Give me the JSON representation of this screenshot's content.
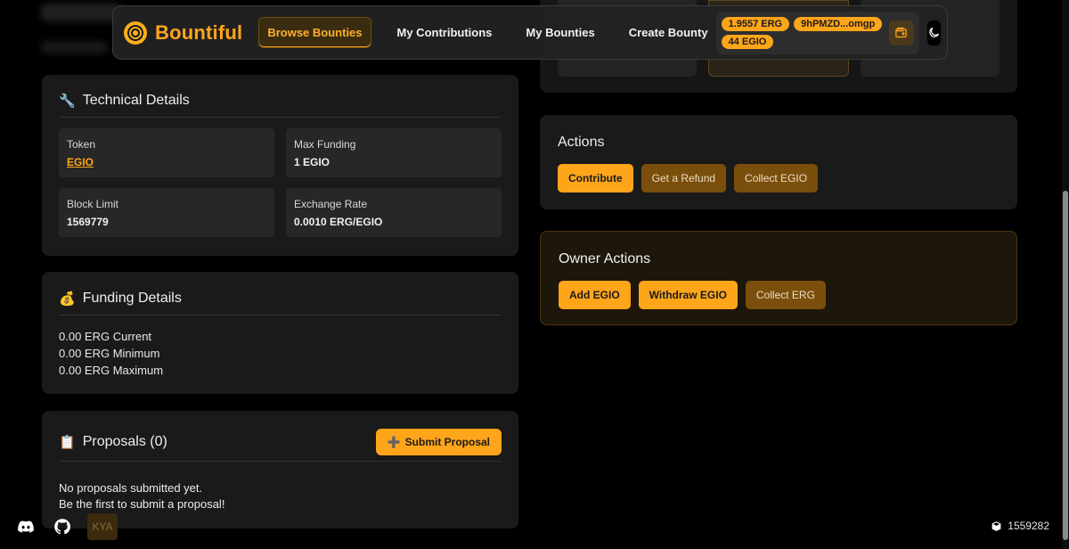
{
  "nav": {
    "brand": "Bountiful",
    "items": [
      {
        "label": "Browse Bounties",
        "active": true
      },
      {
        "label": "My Contributions",
        "active": false
      },
      {
        "label": "My Bounties",
        "active": false
      },
      {
        "label": "Create Bounty",
        "active": false
      }
    ],
    "wallet": {
      "erg_balance": "1.9557 ERG",
      "address": "9hPMZD...omgp",
      "token_balance": "44 EGIO"
    }
  },
  "technical": {
    "title": "Technical Details",
    "icon": "wrench-icon",
    "token_label": "Token",
    "token_value": "EGIO",
    "max_funding_label": "Max Funding",
    "max_funding_value": "1 EGIO",
    "block_limit_label": "Block Limit",
    "block_limit_value": "1569779",
    "exchange_rate_label": "Exchange Rate",
    "exchange_rate_value": "0.0010 ERG/EGIO"
  },
  "funding": {
    "title": "Funding Details",
    "icon": "money-bag-icon",
    "current": "0.00 ERG Current",
    "minimum": "0.00 ERG Minimum",
    "maximum": "0.00 ERG Maximum"
  },
  "proposals": {
    "title": "Proposals (0)",
    "icon": "clipboard-icon",
    "submit_label": "Submit Proposal",
    "empty_line1": "No proposals submitted yet.",
    "empty_line2": "Be the first to submit a proposal!"
  },
  "actions": {
    "title": "Actions",
    "contribute": "Contribute",
    "refund": "Get a Refund",
    "collect": "Collect EGIO"
  },
  "owner_actions": {
    "title": "Owner Actions",
    "add": "Add EGIO",
    "withdraw": "Withdraw EGIO",
    "collect": "Collect ERG"
  },
  "footer": {
    "kya": "KYA",
    "block_height": "1559282"
  },
  "colors": {
    "accent": "#ffa51a",
    "card": "#1a1a1a",
    "muted_button": "#7a4f0c"
  }
}
